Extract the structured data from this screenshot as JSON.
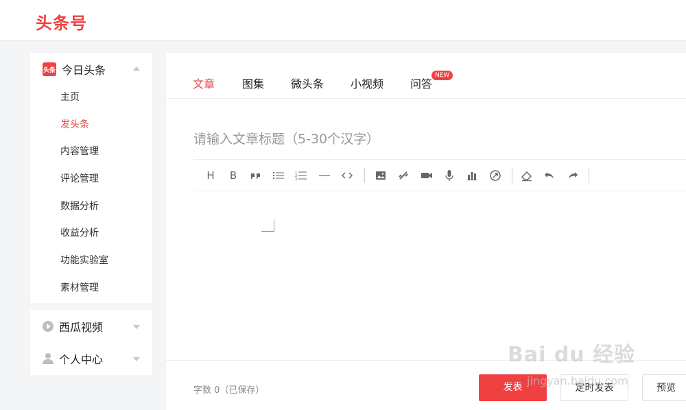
{
  "header": {
    "logo": "头条号"
  },
  "sidebar": {
    "section1": {
      "icon_text": "头条",
      "title": "今日头条",
      "items": [
        {
          "label": "主页"
        },
        {
          "label": "发头条"
        },
        {
          "label": "内容管理"
        },
        {
          "label": "评论管理"
        },
        {
          "label": "数据分析"
        },
        {
          "label": "收益分析"
        },
        {
          "label": "功能实验室"
        },
        {
          "label": "素材管理"
        }
      ],
      "active_item": "发头条"
    },
    "section2": {
      "title": "西瓜视频"
    },
    "section3": {
      "title": "个人中心"
    }
  },
  "tabs": [
    {
      "label": "文章"
    },
    {
      "label": "图集"
    },
    {
      "label": "微头条"
    },
    {
      "label": "小视频"
    },
    {
      "label": "问答"
    }
  ],
  "active_tab": "文章",
  "new_badge": "NEW",
  "editor": {
    "title_placeholder": "请输入文章标题（5-30个汉字）",
    "toolbar": [
      "heading-icon",
      "bold-icon",
      "quote-icon",
      "bullet-list-icon",
      "numbered-list-icon",
      "divider-icon",
      "code-icon",
      "image-icon",
      "link-icon",
      "video-icon",
      "audio-icon",
      "chart-icon",
      "embed-icon",
      "eraser-icon",
      "undo-icon",
      "redo-icon"
    ]
  },
  "footer": {
    "word_count": "字数 0（已保存）",
    "publish_label": "发表",
    "schedule_label": "定时发表",
    "preview_label": "预览"
  },
  "watermark": {
    "brand": "Bai du 经验",
    "url": "jingyan.baidu.com"
  },
  "colors": {
    "accent": "#f04142",
    "text": "#222222",
    "muted": "#999999"
  }
}
